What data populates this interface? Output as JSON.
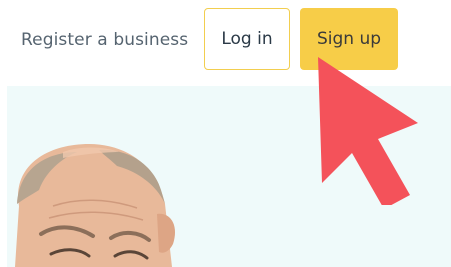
{
  "header": {
    "register_label": "Register a business",
    "login_label": "Log in",
    "signup_label": "Sign up"
  },
  "colors": {
    "accent_yellow": "#f7cd48",
    "login_border": "#f2ce4f",
    "hero_background": "#effafa",
    "arrow_red": "#f4525a"
  },
  "icons": {
    "annotation": "red-arrow-icon"
  }
}
